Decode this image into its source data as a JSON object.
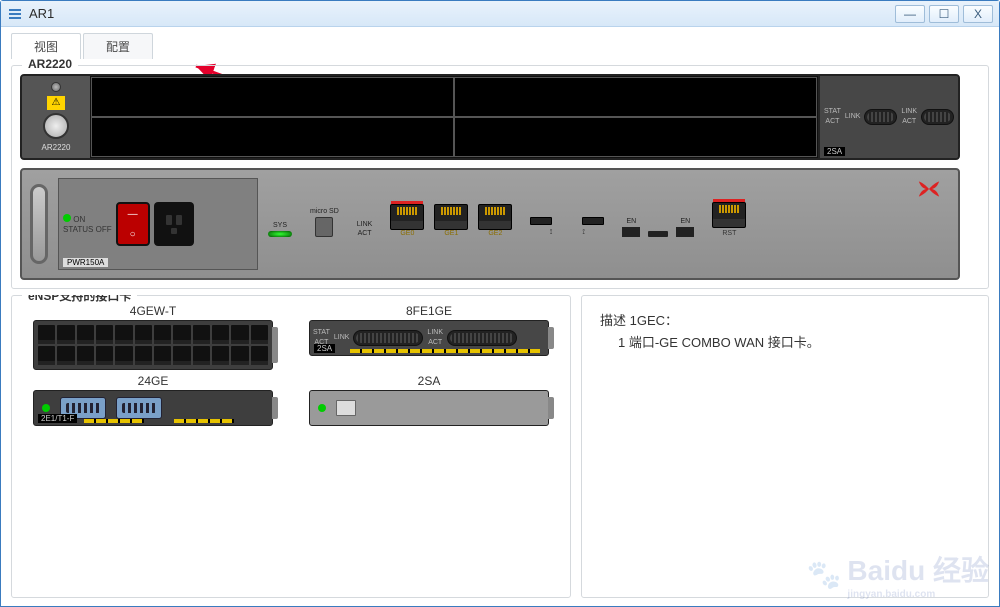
{
  "window": {
    "title": "AR1",
    "buttons": {
      "min": "—",
      "max": "☐",
      "close": "X"
    }
  },
  "tabs": {
    "view": "视图",
    "config": "配置",
    "active": 0
  },
  "device": {
    "model": "AR2220",
    "top_left_label": "AR2220",
    "right_module": {
      "labels": {
        "stat": "STAT",
        "link": "LINK",
        "act": "ACT"
      },
      "tag": "2SA"
    },
    "front": {
      "psu": {
        "on": "ON",
        "off": "OFF",
        "status": "STATUS",
        "model": "PWR150A"
      },
      "labels": {
        "sys": "SYS",
        "microsd": "micro SD",
        "link": "LINK",
        "act": "ACT",
        "ge0": "GE0",
        "ge1": "GE1",
        "ge2": "GE2",
        "usb": "USB",
        "en0": "EN",
        "en1": "EN",
        "rst": "RST"
      }
    }
  },
  "cards": {
    "title": "eNSP支持的接口卡",
    "items": [
      {
        "name": "4GEW-T",
        "kind": "switch24"
      },
      {
        "name": "8FE1GE",
        "kind": "sa"
      },
      {
        "name": "24GE",
        "kind": "serial"
      },
      {
        "name": "2SA",
        "kind": "console"
      }
    ]
  },
  "description": {
    "title": "描述 1GEC：",
    "body": "1 端口-GE COMBO WAN 接口卡。"
  },
  "watermark": {
    "brand": "Baidu",
    "sub": "经验",
    "url": "jingyan.baidu.com"
  }
}
